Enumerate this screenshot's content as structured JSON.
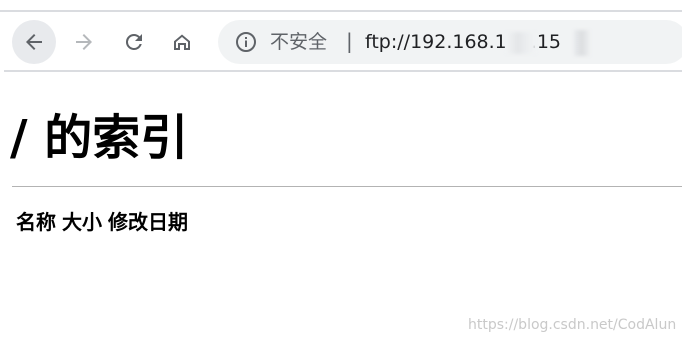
{
  "browser": {
    "nav": {
      "back": "back-arrow",
      "forward": "forward-arrow",
      "reload": "reload",
      "home": "home"
    },
    "omnibox": {
      "info_icon": "info-circle",
      "security_label": "不安全",
      "separator": "|",
      "url_visible": "ftp://192.168.1",
      "url_tail": ".15"
    }
  },
  "content": {
    "title": "/ 的索引",
    "columns": [
      "名称",
      "大小",
      "修改日期"
    ]
  },
  "watermark": "https://blog.csdn.net/CodAlun",
  "colors": {
    "toolbar_icon": "#5f6368",
    "omnibox_bg": "#f1f3f4",
    "divider": "#dadce0",
    "text": "#000000"
  }
}
